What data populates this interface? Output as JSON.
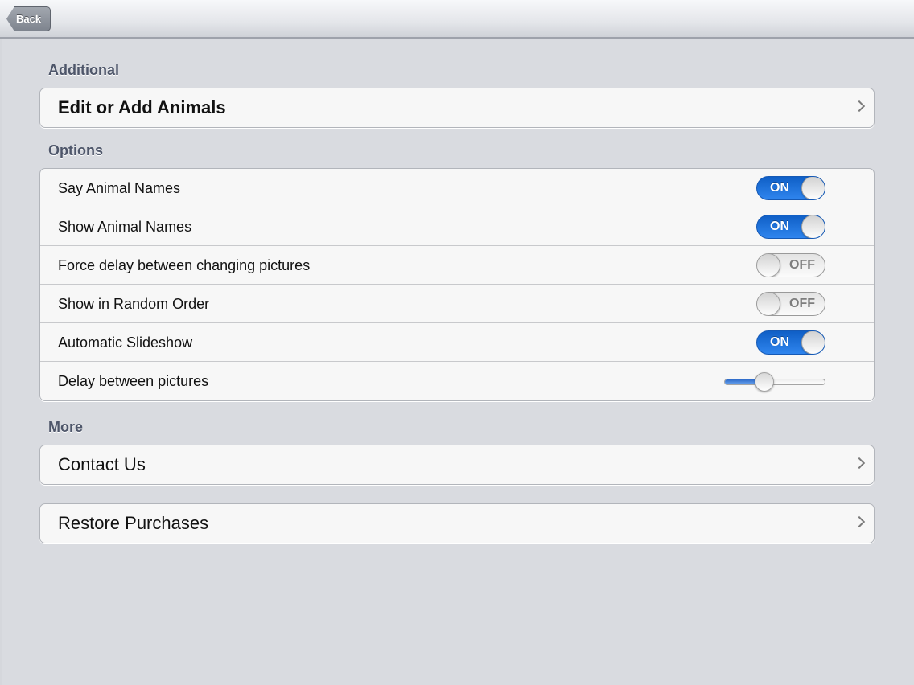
{
  "navbar": {
    "back_label": "Back"
  },
  "sections": {
    "additional": {
      "header": "Additional",
      "edit_animals_label": "Edit or Add Animals"
    },
    "options": {
      "header": "Options",
      "rows": [
        {
          "label": "Say Animal Names",
          "state": "ON"
        },
        {
          "label": "Show Animal Names",
          "state": "ON"
        },
        {
          "label": "Force delay between changing pictures",
          "state": "OFF"
        },
        {
          "label": "Show in Random Order",
          "state": "OFF"
        },
        {
          "label": "Automatic Slideshow",
          "state": "ON"
        }
      ],
      "delay": {
        "label": "Delay between pictures",
        "value_fraction": 0.4
      }
    },
    "more": {
      "header": "More",
      "contact_label": "Contact Us",
      "restore_label": "Restore Purchases"
    }
  },
  "colors": {
    "toggle_on": "#1f74e0",
    "section_header": "#4e566a",
    "background": "#d9dbe0"
  },
  "icons": {
    "chevron": "chevron-right-icon"
  }
}
